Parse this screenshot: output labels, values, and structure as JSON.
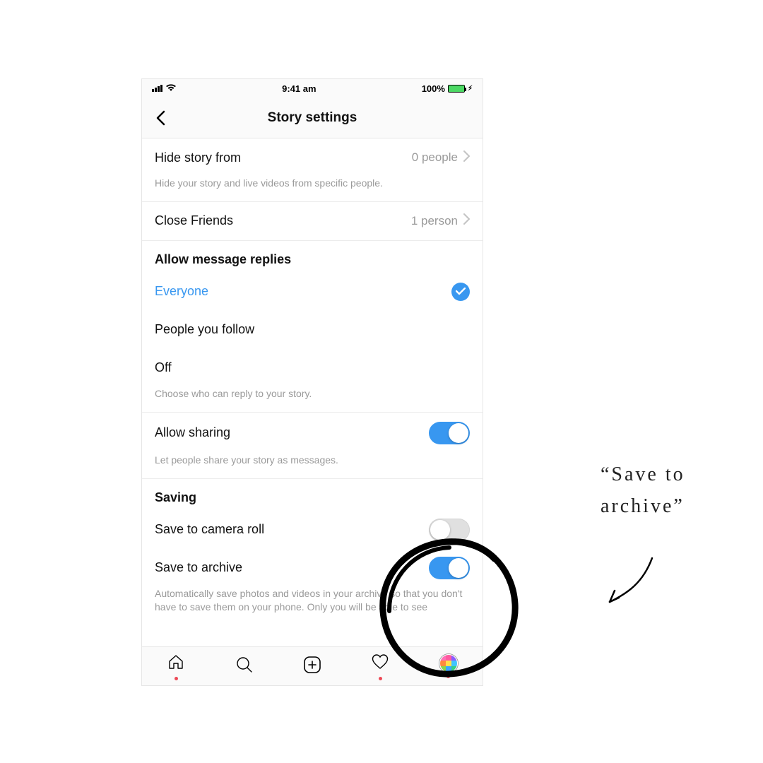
{
  "status": {
    "time": "9:41 am",
    "battery_pct": "100%"
  },
  "header": {
    "title": "Story settings"
  },
  "hide_story": {
    "label": "Hide story from",
    "value": "0 people",
    "caption": "Hide your story and live videos from specific people."
  },
  "close_friends": {
    "label": "Close Friends",
    "value": "1 person"
  },
  "replies": {
    "header": "Allow message replies",
    "options": {
      "everyone": "Everyone",
      "follow": "People you follow",
      "off": "Off"
    },
    "selected": "everyone",
    "caption": "Choose who can reply to your story."
  },
  "sharing": {
    "label": "Allow sharing",
    "on": true,
    "caption": "Let people share your story as messages."
  },
  "saving": {
    "header": "Saving",
    "camera_roll_label": "Save to camera roll",
    "camera_roll_on": false,
    "archive_label": "Save to archive",
    "archive_on": true,
    "caption": "Automatically save photos and videos in your archive so that you don't have to save them on your phone. Only you will be able to see"
  },
  "annotation": {
    "line1": "“Save to",
    "line2": "archive”"
  }
}
